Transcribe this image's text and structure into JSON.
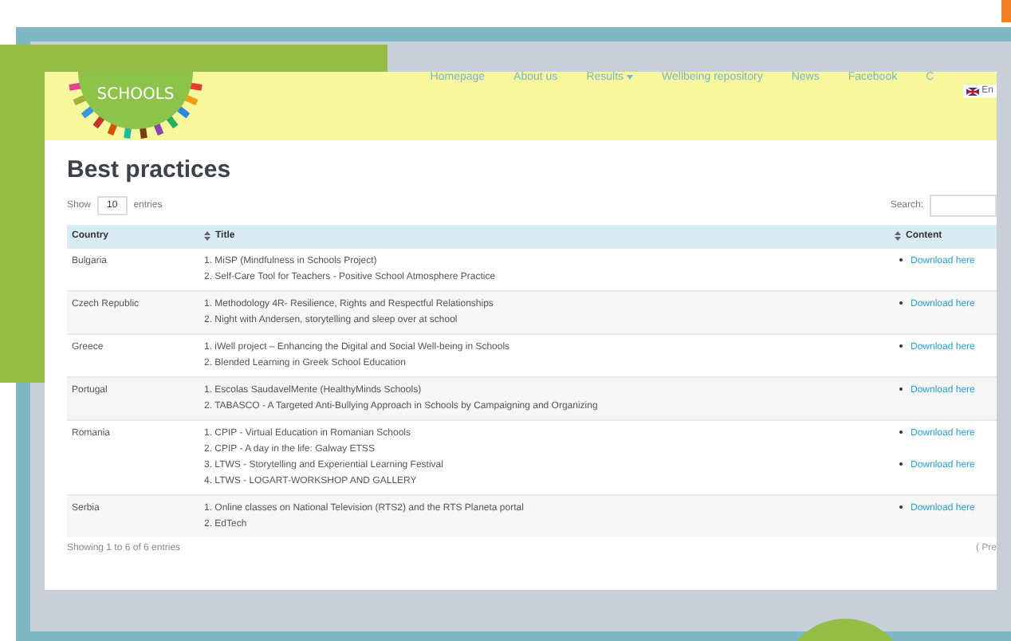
{
  "header": {
    "logo_text": "SCHOOLS",
    "nav": [
      {
        "label": "Homepage",
        "dropdown": false
      },
      {
        "label": "About us",
        "dropdown": false
      },
      {
        "label": "Results",
        "dropdown": true
      },
      {
        "label": "Wellbeing repository",
        "dropdown": false
      },
      {
        "label": "News",
        "dropdown": false
      },
      {
        "label": "Facebook",
        "dropdown": false
      },
      {
        "label": "C",
        "dropdown": false
      }
    ],
    "language": "En"
  },
  "title": "Best practices",
  "length_control": {
    "show_label": "Show",
    "value": "10",
    "entries_label": "entries"
  },
  "search": {
    "label": "Search:"
  },
  "table": {
    "columns": [
      {
        "label": "Country",
        "sortable": false
      },
      {
        "label": "Title",
        "sortable": true
      },
      {
        "label": "Content",
        "sortable": true
      }
    ],
    "rows": [
      {
        "country": "Bulgaria",
        "titles": [
          {
            "text": "1. MiSP (Mindfulness in Schools Project)",
            "link": "Download here"
          },
          {
            "text": "2. Self-Care Tool for Teachers - Positive School Atmosphere Practice"
          }
        ]
      },
      {
        "country": "Czech Republic",
        "titles": [
          {
            "text": "1. Methodology 4R- Resilience, Rights and Respectful Relationships",
            "link": "Download here"
          },
          {
            "text": "2. Night with Andersen, storytelling and sleep over at school"
          }
        ]
      },
      {
        "country": "Greece",
        "titles": [
          {
            "text": "1. iWell project – Enhancing the Digital and Social Well-being in Schools",
            "link": "Download here"
          },
          {
            "text": "2. Blended Learning in Greek School Education"
          }
        ]
      },
      {
        "country": "Portugal",
        "titles": [
          {
            "text": "1. Escolas SaudavelMente (HealthyMinds Schools)",
            "link": "Download here"
          },
          {
            "text": "2. TABASCO - A Targeted Anti-Bullying Approach in Schools by Campaigning and Organizing"
          }
        ]
      },
      {
        "country": "Romania",
        "titles": [
          {
            "text": "1. CPIP - Virtual Education in Romanian Schools",
            "link": "Download here"
          },
          {
            "text": "2. CPIP - A day in the life: Galway ETSS"
          },
          {
            "text": "3. LTWS - Storytelling and Experiential Learning Festival",
            "link": "Download here"
          },
          {
            "text": "4. LTWS - LOGART-WORKSHOP AND GALLERY"
          }
        ]
      },
      {
        "country": "Serbia",
        "titles": [
          {
            "text": "1. Online classes on National Television (RTS2) and the RTS Planeta portal",
            "link": "Download here"
          },
          {
            "text": "2. EdTech"
          }
        ]
      }
    ]
  },
  "footer": {
    "info": "Showing 1 to 6 of 6 entries",
    "prev": "( Pre"
  }
}
